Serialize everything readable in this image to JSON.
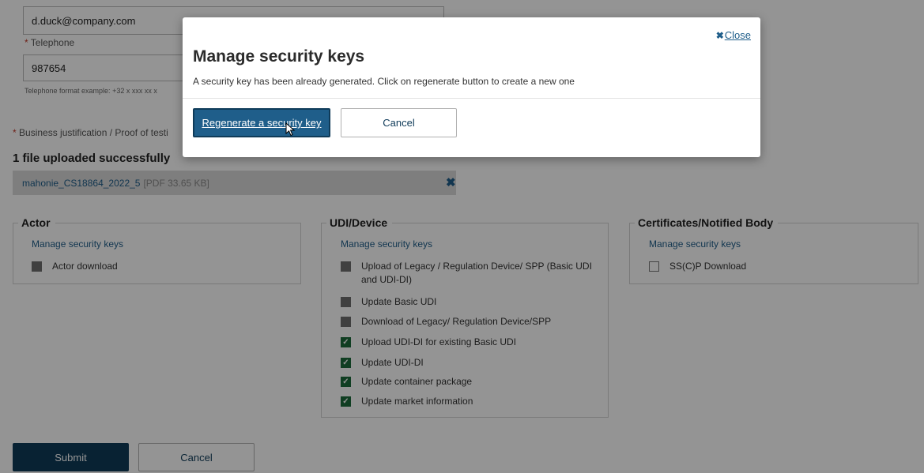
{
  "form": {
    "email_value": "d.duck@company.com",
    "telephone_label": "Telephone",
    "telephone_value": "987654",
    "telephone_hint": "Telephone format example: +32 x xxx xx x",
    "required_mark": "*",
    "justification_label": "Business justification / Proof of testi",
    "upload_status": "1 file uploaded successfully",
    "file_name": "mahonie_CS18864_2022_5",
    "file_meta": "[PDF 33.65 KB]",
    "remove_icon": "close-x-icon"
  },
  "groups": {
    "actor": {
      "title": "Actor",
      "link": "Manage security keys",
      "items": [
        {
          "label": "Actor download",
          "state": "disabled"
        }
      ]
    },
    "udi": {
      "title": "UDI/Device",
      "link": "Manage security keys",
      "items": [
        {
          "label": "Upload of Legacy / Regulation Device/ SPP (Basic UDI and UDI-DI)",
          "state": "disabled"
        },
        {
          "label": "Update Basic UDI",
          "state": "disabled"
        },
        {
          "label": "Download of Legacy/ Regulation Device/SPP",
          "state": "disabled"
        },
        {
          "label": "Upload UDI-DI for existing Basic UDI",
          "state": "checked"
        },
        {
          "label": "Update UDI-DI",
          "state": "checked"
        },
        {
          "label": "Update container package",
          "state": "checked"
        },
        {
          "label": "Update market information",
          "state": "checked"
        }
      ]
    },
    "certs": {
      "title": "Certificates/Notified Body",
      "link": "Manage security keys",
      "items": [
        {
          "label": "SS(C)P Download",
          "state": "unchecked"
        }
      ]
    }
  },
  "footer": {
    "submit_label": "Submit",
    "cancel_label": "Cancel"
  },
  "modal": {
    "title": "Manage security keys",
    "message": "A security key has been already generated. Click on regenerate button to create a new one",
    "close_label": "Close",
    "close_icon": "x-icon",
    "regenerate_label": "Regenerate a security key",
    "cancel_label": "Cancel"
  },
  "colors": {
    "primary": "#0f3b59",
    "link": "#1f5e8a",
    "checked": "#1d6b3c",
    "disabled_checkbox": "#6f6f6f",
    "overlay": "rgba(0,0,0,0.42)"
  }
}
